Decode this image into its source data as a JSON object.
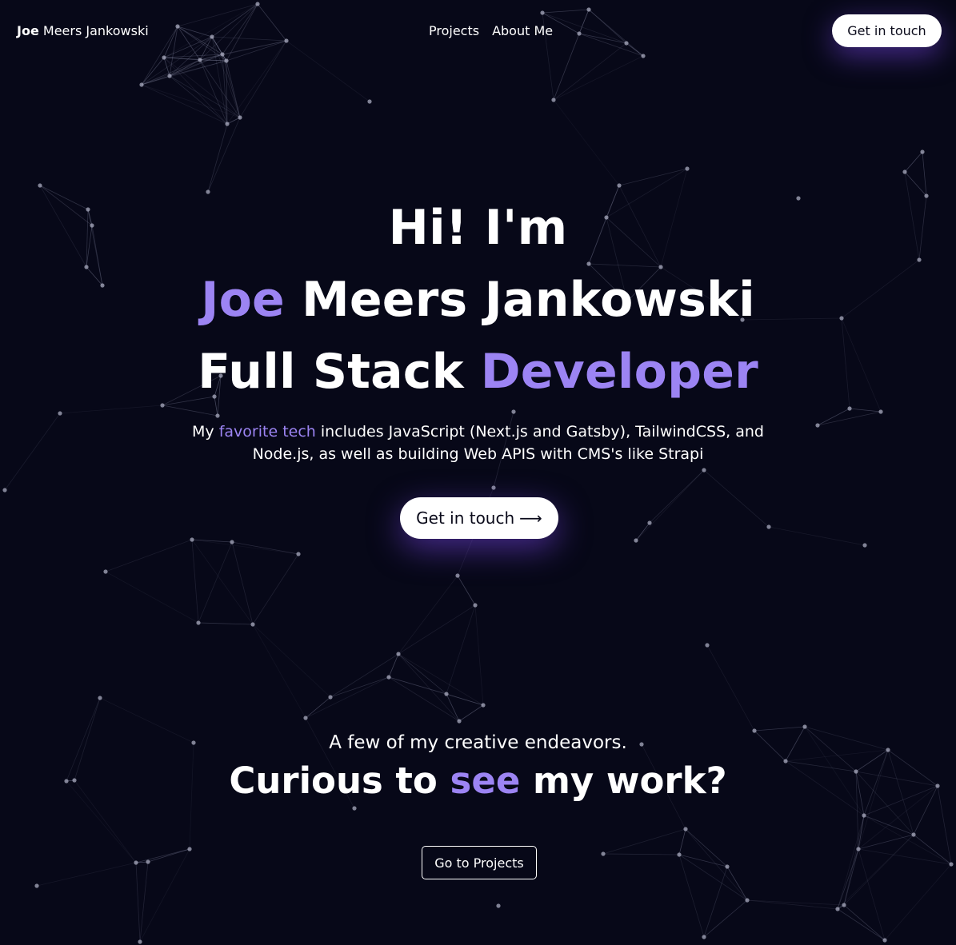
{
  "header": {
    "logo_first": "Joe",
    "logo_rest": " Meers Jankowski",
    "nav": [
      {
        "label": "Projects"
      },
      {
        "label": "About Me"
      }
    ],
    "cta_label": "Get in touch"
  },
  "hero": {
    "greeting": "Hi! I'm",
    "name_accent": "Joe",
    "name_rest": " Meers Jankowski",
    "role_plain": "Full Stack ",
    "role_accent": "Developer",
    "desc_before": "My ",
    "desc_accent": "favorite tech",
    "desc_after": " includes JavaScript (Next.js and Gatsby), TailwindCSS, and Node.js, as well as building Web APIS with CMS's like Strapi",
    "cta_label": "Get in touch",
    "cta_arrow": "⟶"
  },
  "work": {
    "subtitle": "A few of my creative endeavors.",
    "title_before": "Curious to ",
    "title_accent": "see",
    "title_after": " my work?",
    "cta_label": "Go to Projects"
  },
  "theme": {
    "background": "#070818",
    "accent": "#9c84f3",
    "button_bg": "#ffffff",
    "button_glow": "#7846e6"
  }
}
